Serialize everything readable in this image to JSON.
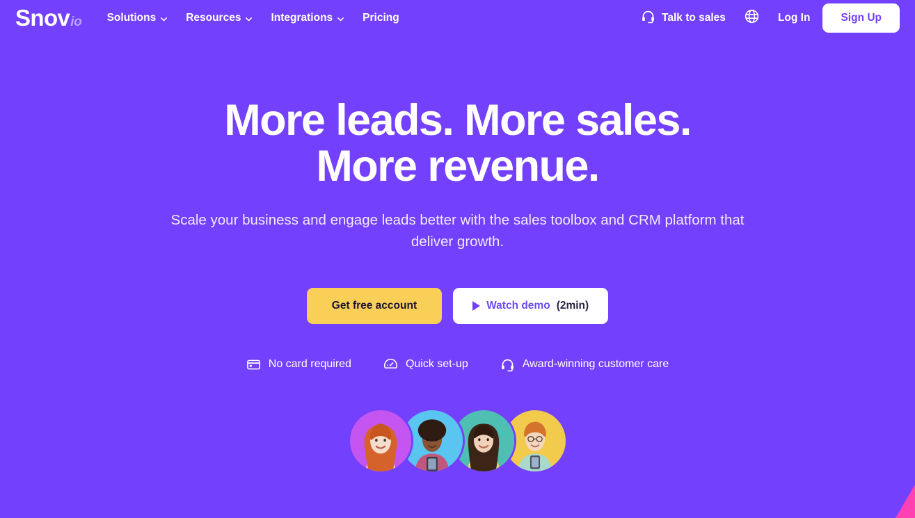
{
  "brand": {
    "logo_main": "Snov",
    "logo_sub": "io",
    "purple": "#7340fd",
    "yellow": "#f9cf58",
    "accent_pink": "#ff41b4"
  },
  "navbar": {
    "links": [
      {
        "label": "Solutions",
        "icon": "chevron-down-icon",
        "has_dropdown": true
      },
      {
        "label": "Resources",
        "icon": "chevron-down-icon",
        "has_dropdown": true
      },
      {
        "label": "Integrations",
        "icon": "chevron-down-icon",
        "has_dropdown": true
      },
      {
        "label": "Pricing",
        "icon": "",
        "has_dropdown": false
      }
    ],
    "talk_to_sales": {
      "label": "Talk to sales",
      "icon": "headset-icon"
    },
    "language": {
      "icon": "globe-icon"
    },
    "login_label": "Log In",
    "signup_label": "Sign Up"
  },
  "hero": {
    "headline_line1": "More leads. More sales.",
    "headline_line2": "More revenue.",
    "subheadline": "Scale your business and engage leads better with the sales toolbox and CRM platform that deliver growth.",
    "primary_cta": "Get free account",
    "secondary_cta_label": "Watch demo",
    "secondary_cta_time": "(2min)",
    "secondary_cta_icon": "play-icon",
    "badges": [
      {
        "label": "No card required",
        "icon": "credit-card-icon"
      },
      {
        "label": "Quick set-up",
        "icon": "speedometer-icon"
      },
      {
        "label": "Award-winning customer care",
        "icon": "headset-icon"
      }
    ],
    "avatars": [
      {
        "name": "avatar-1",
        "bg": "#c455f0"
      },
      {
        "name": "avatar-2",
        "bg": "#5bc5f2"
      },
      {
        "name": "avatar-3",
        "bg": "#4fbfb4"
      },
      {
        "name": "avatar-4",
        "bg": "#f2ca4c"
      }
    ]
  }
}
